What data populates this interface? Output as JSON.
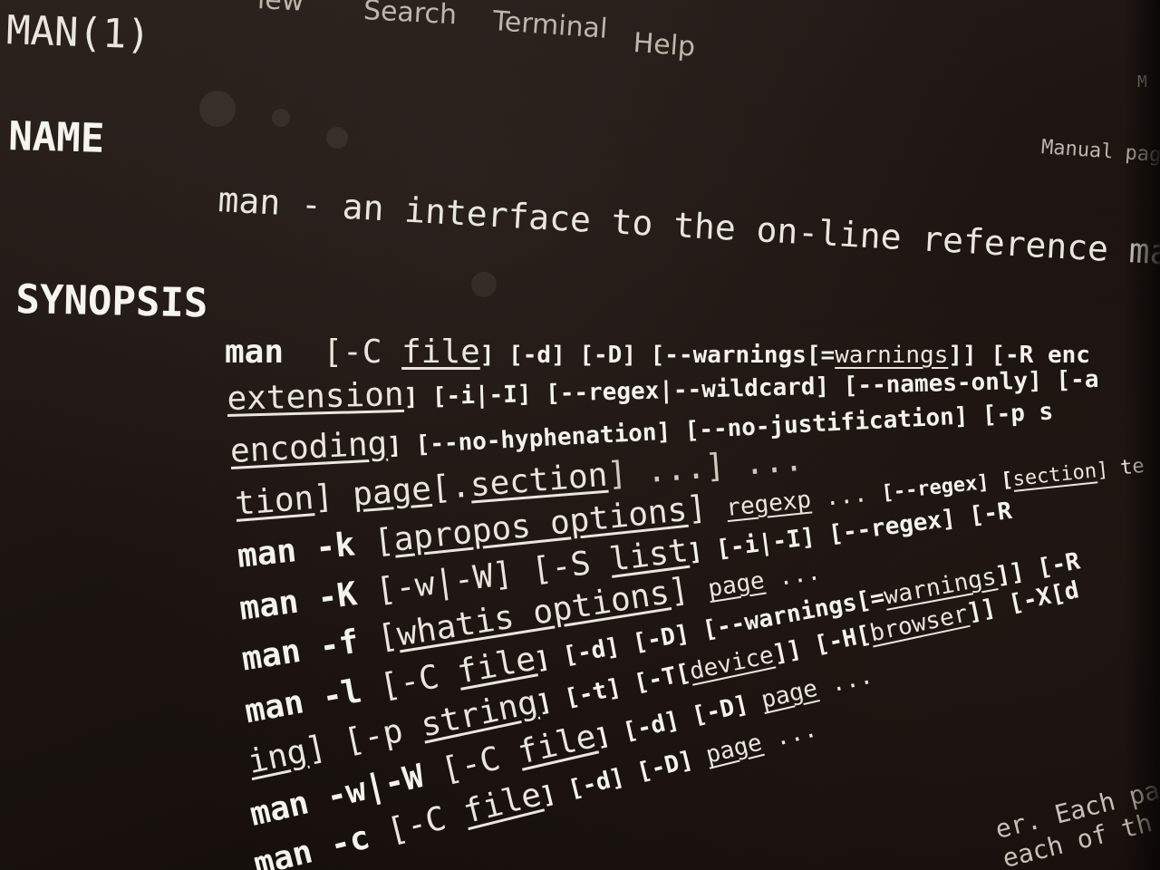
{
  "menubar": {
    "items": [
      "iew",
      "Search",
      "Terminal",
      "Help"
    ]
  },
  "header": {
    "left": "MAN(1)",
    "right": "Manual page",
    "right_edge": "M"
  },
  "sections": {
    "name_heading": "NAME",
    "name_description": "man - an interface to the on-line reference manuals",
    "synopsis_heading": "SYNOPSIS"
  },
  "synopsis": {
    "l1": {
      "cmd": "man",
      "a": "[-C ",
      "a_u": "file",
      "b": "] [-d] [-D] [--warnings[=",
      "b_u": "warnings",
      "c": "]] [-R enc"
    },
    "l2": {
      "a_u": "extension",
      "b": "] [-i|-I] [--regex|--wildcard] [--names-only] [-a",
      "c": ""
    },
    "l3": {
      "a_u": "encoding",
      "b": "] [--no-hyphenation] [--no-justification] [-p s"
    },
    "l4": {
      "a_u": "tion",
      "b": "] ",
      "b_u": "page",
      "c": "[.",
      "c_u": "section",
      "d": "] ...] ..."
    },
    "l5": {
      "cmd": "man -k",
      "a": " [",
      "a_u": "apropos options",
      "b": "] ",
      "b_u": "regexp",
      "c": " ... ",
      "d": "[--regex] [",
      "d_u": "section",
      "e": "] te"
    },
    "l6": {
      "cmd": "man -K",
      "a": " [-w|-W] [-S ",
      "a_u": "list",
      "b": "] [-i|-I] [--regex] [-R"
    },
    "l7": {
      "cmd": "man -f",
      "a": " [",
      "a_u": "whatis options",
      "b": "] ",
      "b_u": "page",
      "c": " ..."
    },
    "l8": {
      "cmd": "man -l",
      "a": " [-C ",
      "a_u": "file",
      "b": "] [-d] [-D] [--warnings[=",
      "b_u": "warnings",
      "c": "]] [-R"
    },
    "l9": {
      "a_u": "ing",
      "b": "] [-p ",
      "b_u": "string",
      "c": "] [-t] [-T[",
      "c_u": "device",
      "d": "]] [-H[",
      "d_u": "browser",
      "e": "]] [-X[d"
    },
    "l10": {
      "cmd": "man -w|-W",
      "a": " [-C ",
      "a_u": "file",
      "b": "] [-d] [-D] ",
      "b_u": "page",
      "c": " ..."
    },
    "l11": {
      "cmd": "man -c",
      "a": " [-C ",
      "a_u": "file",
      "b": "] [-d] [-D] ",
      "b_u": "page",
      "c": " ..."
    }
  },
  "footer": {
    "line1": "er.  Each page argu",
    "line2": "each of th"
  }
}
